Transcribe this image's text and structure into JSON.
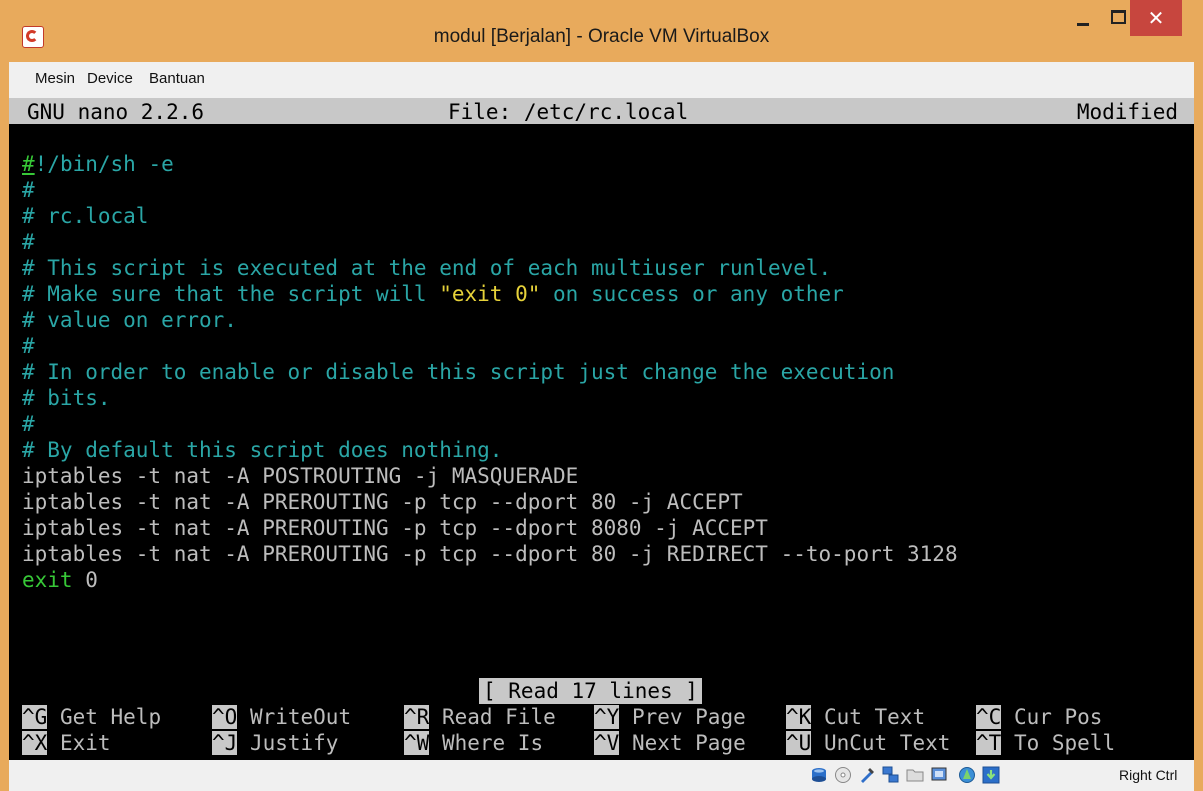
{
  "window": {
    "title": "modul [Berjalan] - Oracle VM VirtualBox",
    "controls": {
      "minimize": "minimize-icon",
      "maximize": "maximize-icon",
      "close": "close-icon"
    }
  },
  "menubar": {
    "items": [
      {
        "label": "Mesin"
      },
      {
        "label": "Device"
      },
      {
        "label": "Bantuan"
      }
    ]
  },
  "nano": {
    "version": "GNU nano 2.2.6",
    "file": "File: /etc/rc.local",
    "state": "Modified",
    "status_message": "[ Read 17 lines ]",
    "lines": [
      {
        "text": "!/bin/sh -e",
        "prefix": "#"
      },
      {
        "text": "#"
      },
      {
        "text": "# rc.local"
      },
      {
        "text": "#"
      },
      {
        "text": "# This script is executed at the end of each multiuser runlevel."
      },
      {
        "pre": "# Make sure that the script will ",
        "hl": "\"exit 0\"",
        "post": " on success or any other"
      },
      {
        "text": "# value on error."
      },
      {
        "text": "#"
      },
      {
        "text": "# In order to enable or disable this script just change the execution"
      },
      {
        "text": "# bits."
      },
      {
        "text": "#"
      },
      {
        "text": "# By default this script does nothing."
      },
      {
        "text": "iptables -t nat -A POSTROUTING -j MASQUERADE"
      },
      {
        "text": "iptables -t nat -A PREROUTING -p tcp --dport 80 -j ACCEPT"
      },
      {
        "text": "iptables -t nat -A PREROUTING -p tcp --dport 8080 -j ACCEPT"
      },
      {
        "text": "iptables -t nat -A PREROUTING -p tcp --dport 80 -j REDIRECT --to-port 3128"
      },
      {
        "kw": "exit",
        "rest": " 0"
      }
    ],
    "shortcuts_row1": [
      {
        "key": "^G",
        "label": " Get Help"
      },
      {
        "key": "^O",
        "label": " WriteOut"
      },
      {
        "key": "^R",
        "label": " Read File"
      },
      {
        "key": "^Y",
        "label": " Prev Page"
      },
      {
        "key": "^K",
        "label": " Cut Text"
      },
      {
        "key": "^C",
        "label": " Cur Pos"
      }
    ],
    "shortcuts_row2": [
      {
        "key": "^X",
        "label": " Exit"
      },
      {
        "key": "^J",
        "label": " Justify"
      },
      {
        "key": "^W",
        "label": " Where Is"
      },
      {
        "key": "^V",
        "label": " Next Page"
      },
      {
        "key": "^U",
        "label": " UnCut Text"
      },
      {
        "key": "^T",
        "label": " To Spell"
      }
    ]
  },
  "statusbar": {
    "host_key": "Right Ctrl",
    "icons": [
      "hard-disk-icon",
      "optical-drive-icon",
      "usb-icon",
      "network-icon",
      "shared-folder-icon",
      "display-icon",
      "mouse-integration-icon",
      "keyboard-capture-icon"
    ]
  },
  "colors": {
    "frame": "#e8aa5c",
    "close_button": "#c7463e",
    "terminal_bg": "#000000",
    "comment": "#2aa6a6",
    "string": "#e6d23a",
    "keyword": "#37c837"
  }
}
